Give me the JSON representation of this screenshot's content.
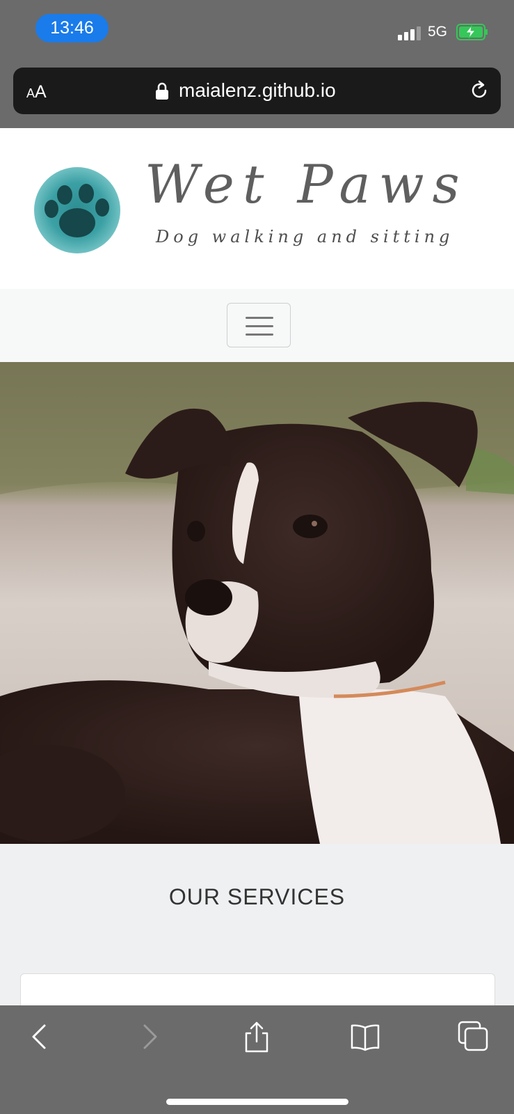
{
  "status_bar": {
    "time": "13:46",
    "network": "5G",
    "battery_color": "#35c759",
    "icons": [
      "signal-icon",
      "battery-charging-icon"
    ]
  },
  "browser": {
    "text_size_label_small": "A",
    "text_size_label_large": "A",
    "url": "maialenz.github.io",
    "icons": [
      "lock-icon",
      "reload-icon"
    ]
  },
  "site": {
    "brand_name": "Wet Paws",
    "tagline": "Dog walking and sitting",
    "logo_icon": "paw-print-icon",
    "logo_color": "#2e8e92",
    "hero_image": "puppy-photo",
    "services_heading": "OUR SERVICES"
  },
  "toolbar": {
    "icons": [
      "back-icon",
      "forward-icon",
      "share-icon",
      "bookmarks-icon",
      "tabs-icon"
    ]
  }
}
